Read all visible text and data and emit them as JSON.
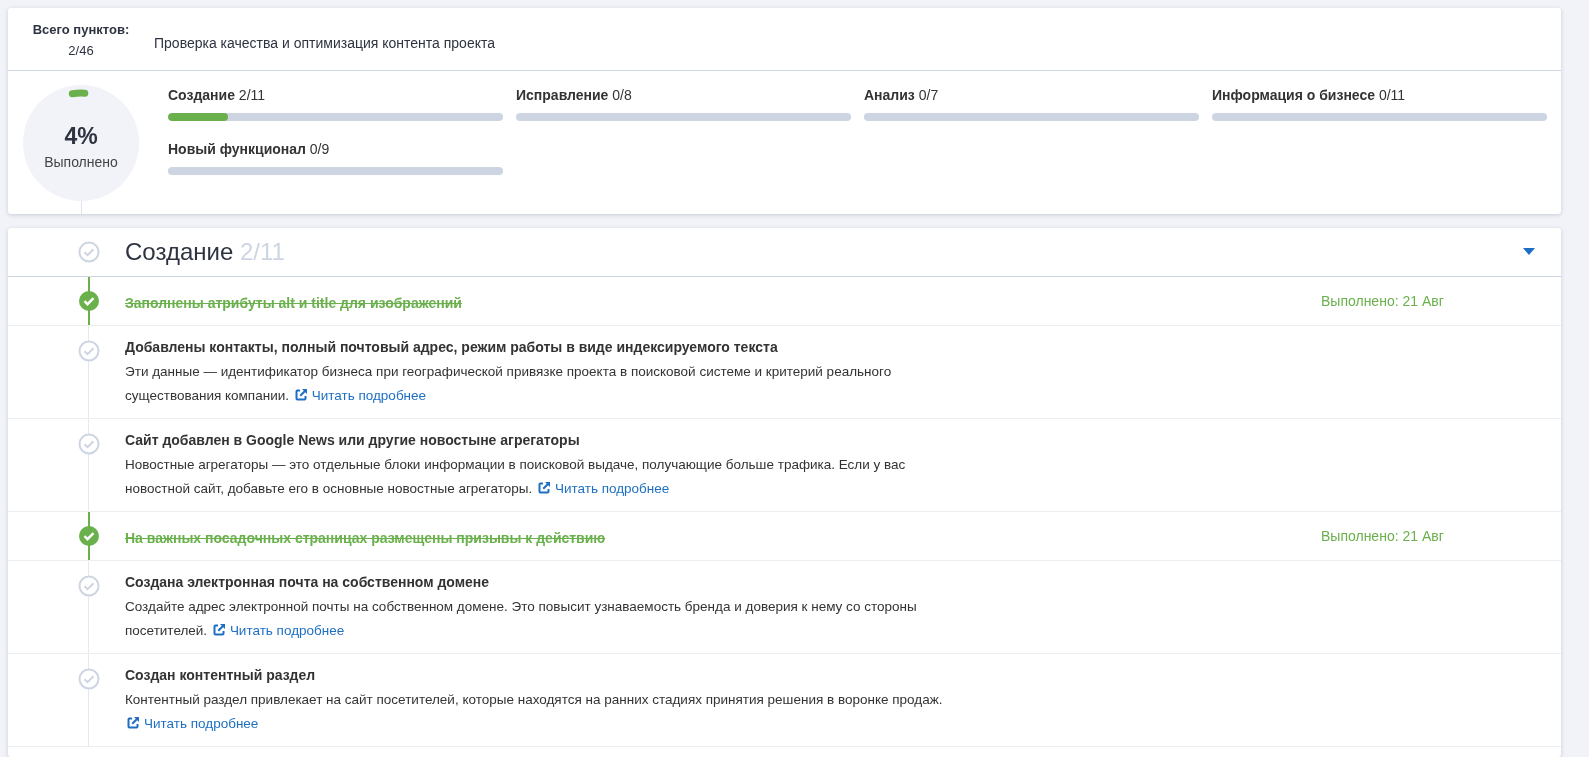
{
  "summary": {
    "total_label": "Всего пунктов:",
    "total_value": "2/46",
    "project_title": "Проверка качества и оптимизация контента проекта",
    "progress": {
      "level": 0.04,
      "percent": "4%",
      "label": "Выполнено"
    }
  },
  "categories": [
    {
      "name": "Создание",
      "count": "2/11",
      "level": 0.18
    },
    {
      "name": "Исправление",
      "count": "0/8"
    },
    {
      "name": "Анализ",
      "count": "0/7"
    },
    {
      "name": "Информация о бизнесе",
      "count": "0/11"
    },
    {
      "name": "Новый функционал",
      "count": "0/9"
    }
  ],
  "section": {
    "title": "Создание",
    "count": "2/11",
    "expanded": true,
    "items": [
      {
        "done": true,
        "title": "Заполнены атрибуты alt и title для изображений",
        "status": "Выполнено: 21 Авг"
      },
      {
        "done": false,
        "title": "Добавлены контакты, полный почтовый адрес, режим работы в виде индексируемого текста",
        "description": "Эти данные — идентификатор бизнеса при географической привязке проекта в поисковой системе и критерий реального существования компании.",
        "link": "Читать подробнее"
      },
      {
        "done": false,
        "title": "Сайт добавлен в Google News или другие новостыне агрегаторы",
        "description": "Новостные агрегаторы — это отдельные блоки информации в поисковой выдаче, получающие больше трафика. Если у вас новостной сайт, добавьте его в основные новостные агрегаторы.",
        "link": "Читать подробнее"
      },
      {
        "done": true,
        "title": "На важных посадочных страницах размещены призывы к действию",
        "status": "Выполнено: 21 Авг"
      },
      {
        "done": false,
        "title": "Создана электронная почта на собственном домене",
        "description": "Создайте адрес электронной почты на собственном домене. Это повысит узнаваемость бренда и доверия к нему со стороны посетителей.",
        "link": "Читать подробнее"
      },
      {
        "done": false,
        "title": "Создан контентный раздел",
        "description": "Контентный раздел привлекает на сайт посетителей, которые находятся на ранних стадиях принятия решения в воронке продаж.",
        "link": "Читать подробнее"
      }
    ]
  }
}
